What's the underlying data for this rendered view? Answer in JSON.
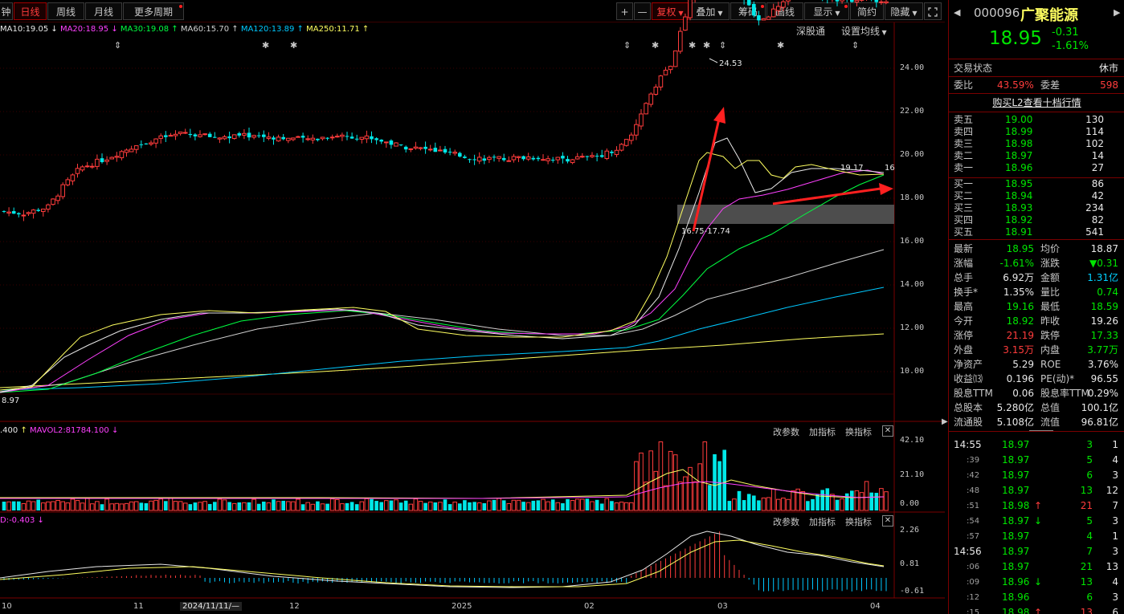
{
  "toolbar": {
    "left_cut": "钟",
    "tabs": [
      {
        "label": "日线"
      },
      {
        "label": "周线"
      },
      {
        "label": "月线"
      },
      {
        "label": "更多周期"
      }
    ],
    "plus": "+",
    "minus": "—",
    "fuquan": "复权",
    "diejia": "叠加",
    "chouma": "筹码",
    "huaxian": "画线",
    "xianshi": "显示",
    "jianyue": "简约",
    "yincang": "隐藏"
  },
  "ma_legend": {
    "ma10": "MA10:19.05",
    "ma20": "MA20:18.95",
    "ma30": "MA30:19.08",
    "ma60": "MA60:15.70",
    "ma120": "MA120:13.89",
    "ma250": "MA250:11.71",
    "shenduotong": "深股通",
    "set_ma": "设置均线"
  },
  "price_axis": [
    "24.00",
    "22.00",
    "20.00",
    "18.00",
    "16.00",
    "14.00",
    "12.00",
    "10.00"
  ],
  "annotations": {
    "high": "24.53",
    "low": "8.97",
    "zone": "16.75-17.74",
    "last_pair": "19.17",
    "last_pair2": "16"
  },
  "vol_panel": {
    "legend_a": ".400",
    "legend_b": "MAVOL2:81784.100",
    "params": "改参数",
    "add_ind": "加指标",
    "switch_ind": "换指标",
    "axis": [
      "42.10",
      "21.10",
      "0.00"
    ]
  },
  "macd_panel": {
    "legend": "D:-0.403",
    "params": "改参数",
    "add_ind": "加指标",
    "switch_ind": "换指标",
    "axis": [
      "2.26",
      "0.81",
      "-0.61"
    ]
  },
  "x_axis": [
    {
      "label": "10"
    },
    {
      "label": "11"
    },
    {
      "label": "2024/11/11/—"
    },
    {
      "label": "12"
    },
    {
      "label": "2025"
    },
    {
      "label": "02"
    },
    {
      "label": "03"
    },
    {
      "label": "04"
    }
  ],
  "stock": {
    "code": "000096",
    "name": "广聚能源",
    "price": "18.95",
    "change": "-0.31",
    "change_pct": "-1.61%"
  },
  "panel": {
    "status_label": "交易状态",
    "status_value": "休市",
    "weibi_label": "委比",
    "weibi_value": "43.59%",
    "weicha_label": "委差",
    "weicha_value": "598",
    "l2_link": "购买L2查看十档行情",
    "asks": [
      {
        "label": "卖五",
        "price": "19.00",
        "vol": "130"
      },
      {
        "label": "卖四",
        "price": "18.99",
        "vol": "114"
      },
      {
        "label": "卖三",
        "price": "18.98",
        "vol": "102"
      },
      {
        "label": "卖二",
        "price": "18.97",
        "vol": "14"
      },
      {
        "label": "卖一",
        "price": "18.96",
        "vol": "27"
      }
    ],
    "bids": [
      {
        "label": "买一",
        "price": "18.95",
        "vol": "86"
      },
      {
        "label": "买二",
        "price": "18.94",
        "vol": "42"
      },
      {
        "label": "买三",
        "price": "18.93",
        "vol": "234"
      },
      {
        "label": "买四",
        "price": "18.92",
        "vol": "82"
      },
      {
        "label": "买五",
        "price": "18.91",
        "vol": "541"
      }
    ],
    "stats": [
      {
        "l1": "最新",
        "v1": "18.95",
        "c1": "green",
        "l2": "均价",
        "v2": "18.87",
        "c2": "white"
      },
      {
        "l1": "涨幅",
        "v1": "-1.61%",
        "c1": "green",
        "l2": "涨跌",
        "v2": "▼0.31",
        "c2": "green"
      },
      {
        "l1": "总手",
        "v1": "6.92万",
        "c1": "white",
        "l2": "金额",
        "v2": "1.31亿",
        "c2": "cyan"
      },
      {
        "l1": "换手*",
        "v1": "1.35%",
        "c1": "white",
        "l2": "量比",
        "v2": "0.74",
        "c2": "green"
      },
      {
        "l1": "最高",
        "v1": "19.16",
        "c1": "green",
        "l2": "最低",
        "v2": "18.59",
        "c2": "green"
      },
      {
        "l1": "今开",
        "v1": "18.92",
        "c1": "green",
        "l2": "昨收",
        "v2": "19.26",
        "c2": "white"
      },
      {
        "l1": "涨停",
        "v1": "21.19",
        "c1": "red",
        "l2": "跌停",
        "v2": "17.33",
        "c2": "green"
      },
      {
        "l1": "外盘",
        "v1": "3.15万",
        "c1": "red",
        "l2": "内盘",
        "v2": "3.77万",
        "c2": "green"
      },
      {
        "l1": "净资产",
        "v1": "5.29",
        "c1": "white",
        "l2": "ROE",
        "v2": "3.76%",
        "c2": "white"
      },
      {
        "l1": "收益⒀",
        "v1": "0.196",
        "c1": "white",
        "l2": "PE(动)*",
        "v2": "96.55",
        "c2": "white"
      },
      {
        "l1": "股息TTM",
        "v1": "0.06",
        "c1": "white",
        "l2": "股息率TTM",
        "v2": "0.29%",
        "c2": "white"
      },
      {
        "l1": "总股本",
        "v1": "5.280亿",
        "c1": "white",
        "l2": "总值",
        "v2": "100.1亿",
        "c2": "white"
      },
      {
        "l1": "流通股",
        "v1": "5.108亿",
        "c1": "white",
        "l2": "流值",
        "v2": "96.81亿",
        "c2": "white"
      }
    ],
    "ticks": [
      {
        "time": "14:55",
        "price": "18.97",
        "arrow": "",
        "vol": "3",
        "vc": "green",
        "n": "1"
      },
      {
        "time": ":39",
        "price": "18.97",
        "arrow": "",
        "vol": "5",
        "vc": "green",
        "n": "4"
      },
      {
        "time": ":42",
        "price": "18.97",
        "arrow": "",
        "vol": "6",
        "vc": "green",
        "n": "3"
      },
      {
        "time": ":48",
        "price": "18.97",
        "arrow": "",
        "vol": "13",
        "vc": "green",
        "n": "12"
      },
      {
        "time": ":51",
        "price": "18.98",
        "arrow": "↑",
        "vol": "21",
        "vc": "red",
        "n": "7"
      },
      {
        "time": ":54",
        "price": "18.97",
        "arrow": "↓",
        "vol": "5",
        "vc": "green",
        "n": "3"
      },
      {
        "time": ":57",
        "price": "18.97",
        "arrow": "",
        "vol": "4",
        "vc": "green",
        "n": "1"
      },
      {
        "time": "14:56",
        "price": "18.97",
        "arrow": "",
        "vol": "7",
        "vc": "green",
        "n": "3"
      },
      {
        "time": ":06",
        "price": "18.97",
        "arrow": "",
        "vol": "21",
        "vc": "green",
        "n": "13"
      },
      {
        "time": ":09",
        "price": "18.96",
        "arrow": "↓",
        "vol": "13",
        "vc": "green",
        "n": "4"
      },
      {
        "time": ":12",
        "price": "18.96",
        "arrow": "",
        "vol": "6",
        "vc": "green",
        "n": "3"
      },
      {
        "time": ":15",
        "price": "18.98",
        "arrow": "↑",
        "vol": "13",
        "vc": "red",
        "n": "6"
      }
    ]
  }
}
